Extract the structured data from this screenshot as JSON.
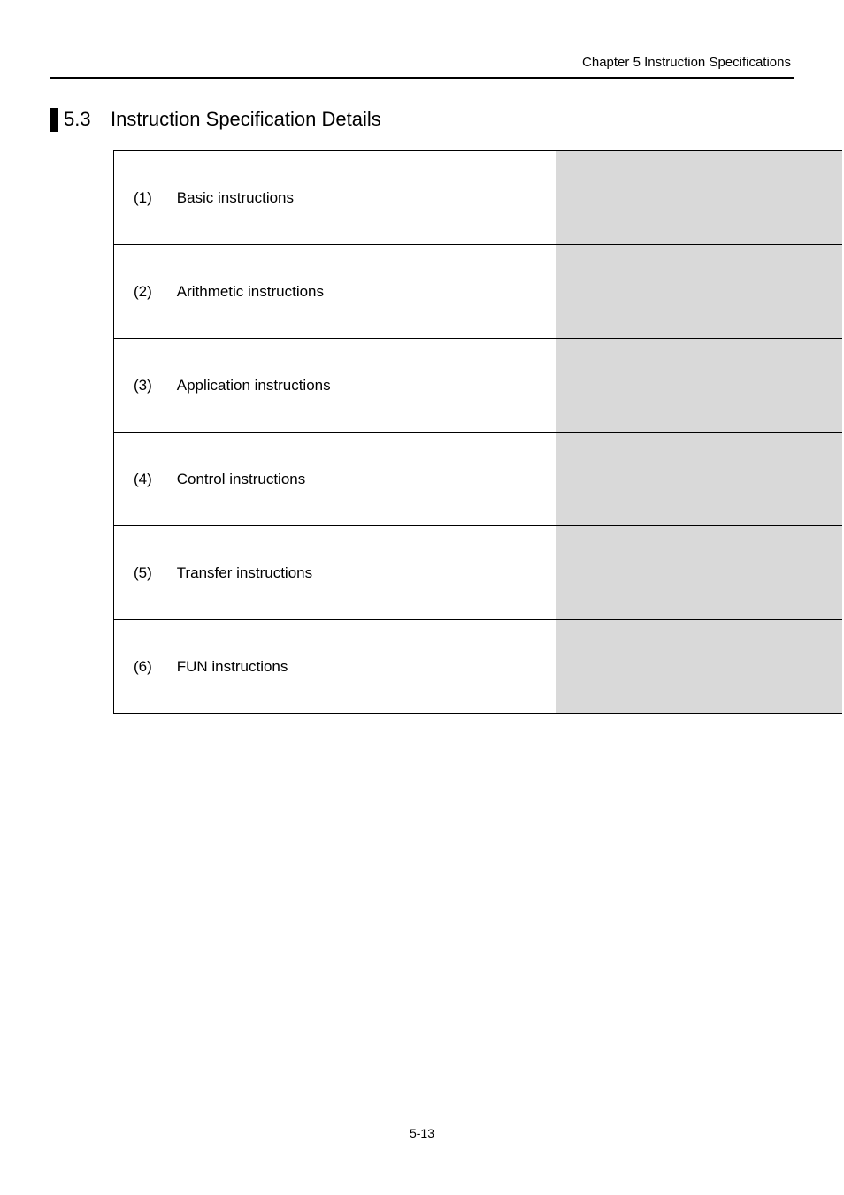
{
  "header": {
    "running_head": "Chapter 5  Instruction Specifications"
  },
  "section": {
    "number": "5.3",
    "title": "Instruction Specification Details"
  },
  "rows": [
    {
      "num": "(1)",
      "label": "Basic instructions"
    },
    {
      "num": "(2)",
      "label": "Arithmetic instructions"
    },
    {
      "num": "(3)",
      "label": "Application instructions"
    },
    {
      "num": "(4)",
      "label": "Control instructions"
    },
    {
      "num": "(5)",
      "label": "Transfer instructions"
    },
    {
      "num": "(6)",
      "label": "FUN instructions"
    }
  ],
  "footer": {
    "page_number": "5-13"
  }
}
